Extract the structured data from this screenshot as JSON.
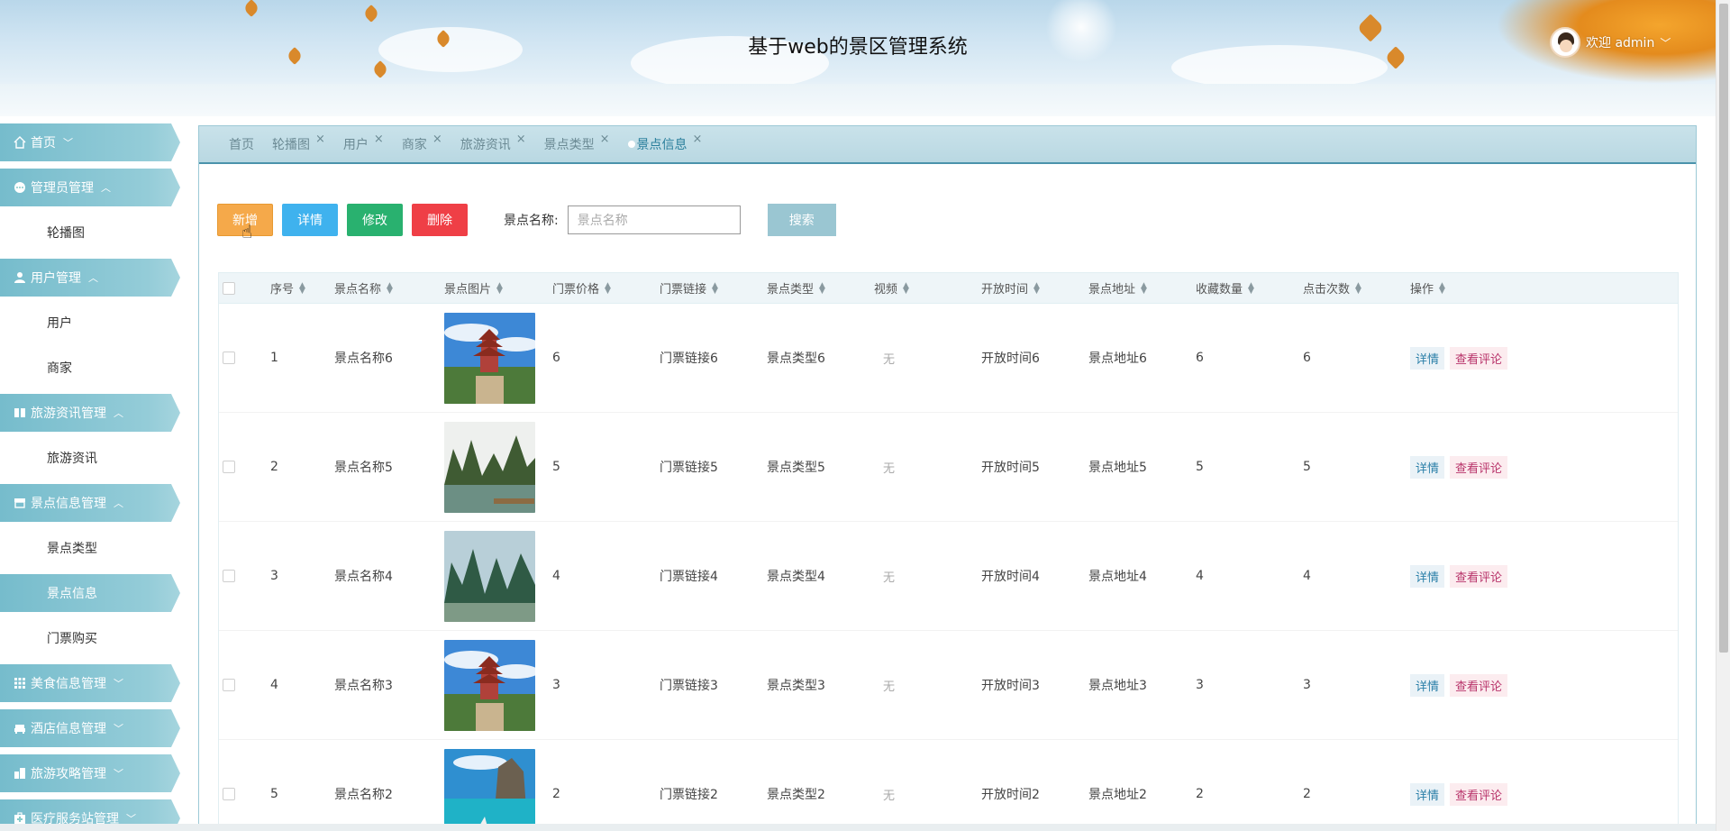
{
  "header": {
    "title": "基于web的景区管理系统",
    "user_greeting": "欢迎 admin"
  },
  "sidebar": {
    "groups": [
      {
        "label": "首页",
        "icon": "home-icon",
        "chevron": "﹀"
      },
      {
        "label": "管理员管理",
        "icon": "chat-bubble-icon",
        "chevron": "︿",
        "items": [
          "轮播图"
        ]
      },
      {
        "label": "用户管理",
        "icon": "person-icon",
        "chevron": "︿",
        "items": [
          "用户",
          "商家"
        ]
      },
      {
        "label": "旅游资讯管理",
        "icon": "book-icon",
        "chevron": "︿",
        "items": [
          "旅游资讯"
        ]
      },
      {
        "label": "景点信息管理",
        "icon": "store-icon",
        "chevron": "︿",
        "items": [
          "景点类型",
          "景点信息",
          "门票购买"
        ]
      },
      {
        "label": "美食信息管理",
        "icon": "grid-icon",
        "chevron": "﹀"
      },
      {
        "label": "酒店信息管理",
        "icon": "sofa-icon",
        "chevron": "﹀"
      },
      {
        "label": "旅游攻略管理",
        "icon": "building-icon",
        "chevron": "﹀"
      },
      {
        "label": "医疗服务站管理",
        "icon": "medical-box-icon",
        "chevron": "﹀"
      }
    ],
    "active_item": "景点信息"
  },
  "tabs": [
    {
      "label": "首页",
      "closable": false
    },
    {
      "label": "轮播图",
      "closable": true
    },
    {
      "label": "用户",
      "closable": true
    },
    {
      "label": "商家",
      "closable": true
    },
    {
      "label": "旅游资讯",
      "closable": true
    },
    {
      "label": "景点类型",
      "closable": true
    },
    {
      "label": "景点信息",
      "closable": true,
      "active": true
    }
  ],
  "tab_close_glyph": "×",
  "toolbar": {
    "add_label": "新增",
    "detail_label": "详情",
    "edit_label": "修改",
    "delete_label": "删除",
    "search_label": "景点名称:",
    "search_placeholder": "景点名称",
    "search_button": "搜索"
  },
  "table": {
    "columns": [
      "序号",
      "景点名称",
      "景点图片",
      "门票价格",
      "门票链接",
      "景点类型",
      "视频",
      "开放时间",
      "景点地址",
      "收藏数量",
      "点击次数",
      "操作"
    ],
    "rows": [
      {
        "index": "1",
        "name": "景点名称6",
        "image": "pagoda",
        "price": "6",
        "link": "门票链接6",
        "type": "景点类型6",
        "video": "无",
        "open": "开放时间6",
        "address": "景点地址6",
        "favorites": "6",
        "clicks": "6"
      },
      {
        "index": "2",
        "name": "景点名称5",
        "image": "karst-river",
        "price": "5",
        "link": "门票链接5",
        "type": "景点类型5",
        "video": "无",
        "open": "开放时间5",
        "address": "景点地址5",
        "favorites": "5",
        "clicks": "5"
      },
      {
        "index": "3",
        "name": "景点名称4",
        "image": "green-mountains",
        "price": "4",
        "link": "门票链接4",
        "type": "景点类型4",
        "video": "无",
        "open": "开放时间4",
        "address": "景点地址4",
        "favorites": "4",
        "clicks": "4"
      },
      {
        "index": "4",
        "name": "景点名称3",
        "image": "pagoda",
        "price": "3",
        "link": "门票链接3",
        "type": "景点类型3",
        "video": "无",
        "open": "开放时间3",
        "address": "景点地址3",
        "favorites": "3",
        "clicks": "3"
      },
      {
        "index": "5",
        "name": "景点名称2",
        "image": "sea-cliff",
        "price": "2",
        "link": "门票链接2",
        "type": "景点类型2",
        "video": "无",
        "open": "开放时间2",
        "address": "景点地址2",
        "favorites": "2",
        "clicks": "2"
      }
    ],
    "row_actions": {
      "detail": "详情",
      "review": "查看评论"
    }
  },
  "colors": {
    "sidebar_accent": "#76bccc",
    "tab_active": "#2a7f9c",
    "add": "#f5a94a",
    "detail": "#3fb2ee",
    "edit": "#29b16f",
    "delete": "#ef3f46",
    "search": "#9ac6d2"
  }
}
